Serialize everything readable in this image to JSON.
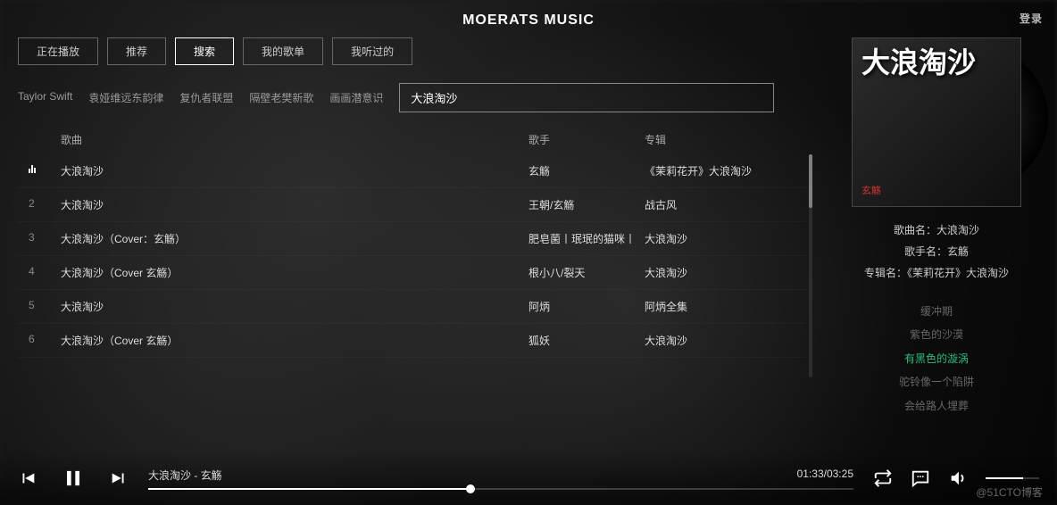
{
  "header": {
    "title": "MOERATS MUSIC",
    "login": "登录"
  },
  "tabs": [
    "正在播放",
    "推荐",
    "搜索",
    "我的歌单",
    "我听过的"
  ],
  "active_tab_index": 2,
  "suggestions": [
    "Taylor Swift",
    "袁娅维远东韵律",
    "复仇者联盟",
    "隔壁老樊新歌",
    "画画潜意识"
  ],
  "search": {
    "value": "大浪淘沙"
  },
  "columns": {
    "song": "歌曲",
    "artist": "歌手",
    "album": "专辑"
  },
  "results": [
    {
      "idx": "",
      "playing": true,
      "title": "大浪淘沙",
      "artist": "玄觞",
      "album": "《茉莉花开》大浪淘沙"
    },
    {
      "idx": "2",
      "playing": false,
      "title": "大浪淘沙",
      "artist": "王朝/玄觞",
      "album": "战古风"
    },
    {
      "idx": "3",
      "playing": false,
      "title": "大浪淘沙（Cover：玄觞）",
      "artist": "肥皂菌丨珉珉的猫咪丨",
      "album": "大浪淘沙"
    },
    {
      "idx": "4",
      "playing": false,
      "title": "大浪淘沙（Cover 玄觞）",
      "artist": "根小八/裂天",
      "album": "大浪淘沙"
    },
    {
      "idx": "5",
      "playing": false,
      "title": "大浪淘沙",
      "artist": "阿炳",
      "album": "阿炳全集"
    },
    {
      "idx": "6",
      "playing": false,
      "title": "大浪淘沙（Cover 玄觞）",
      "artist": "狐妖",
      "album": "大浪淘沙"
    }
  ],
  "now_playing": {
    "cover_text": "大浪淘沙",
    "cover_sub": "玄觞",
    "song_label": "歌曲名：",
    "song": "大浪淘沙",
    "artist_label": "歌手名：",
    "artist": "玄觞",
    "album_label": "专辑名：",
    "album": "《茉莉花开》大浪淘沙"
  },
  "lyrics": {
    "lines": [
      "缓冲期",
      "紫色的沙漠",
      "有黑色的漩涡",
      "驼铃像一个陷阱",
      "会给路人埋葬"
    ],
    "active_index": 2
  },
  "player": {
    "track_label": "大浪淘沙 - 玄觞",
    "time": "01:33/03:25",
    "progress_percent": 45,
    "volume_percent": 70
  },
  "watermark": "@51CTO博客"
}
